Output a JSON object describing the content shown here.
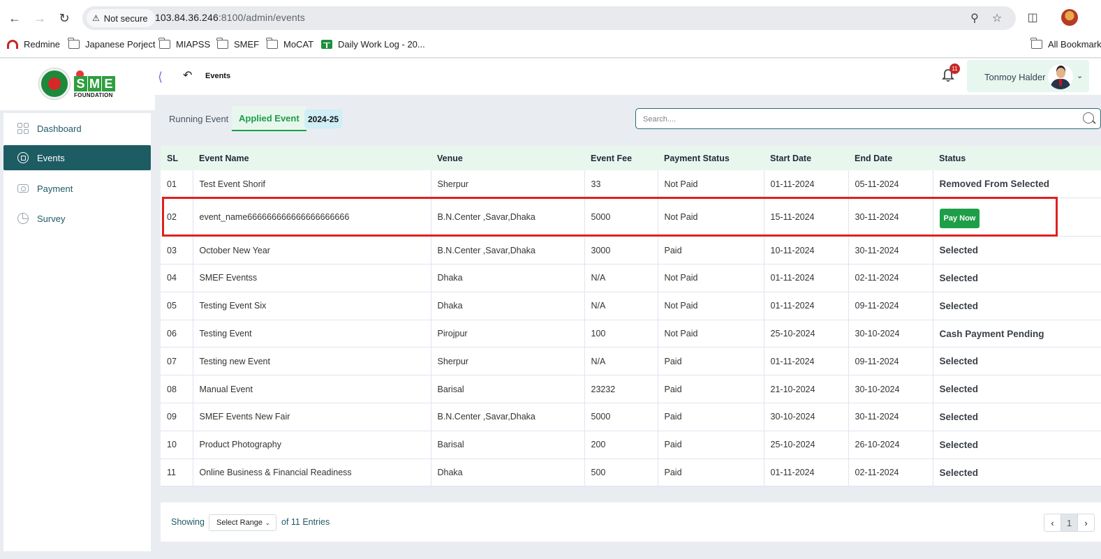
{
  "browser": {
    "security_label": "Not secure",
    "url_host": "103.84.36.246",
    "url_rest": ":8100/admin/events",
    "bookmarks": [
      "Redmine",
      "Japanese Porject",
      "MIAPSS",
      "SMEF",
      "MoCAT",
      "Daily Work Log - 20...",
      "All Bookmark"
    ]
  },
  "logo": {
    "letters": [
      "S",
      "M",
      "E"
    ],
    "sub": "FOUNDATION"
  },
  "header": {
    "title": "Events",
    "notification_count": "11",
    "user_name": "Tonmoy Halder"
  },
  "sidebar": {
    "items": [
      {
        "label": "Dashboard",
        "icon": "dashboard-icon"
      },
      {
        "label": "Events",
        "icon": "events-icon",
        "active": true
      },
      {
        "label": "Payment",
        "icon": "payment-icon"
      },
      {
        "label": "Survey",
        "icon": "survey-icon"
      }
    ]
  },
  "tabs": {
    "running": "Running Event",
    "applied": "Applied Event",
    "year": "2024-25"
  },
  "search": {
    "placeholder": "Search...."
  },
  "table": {
    "columns": [
      "SL",
      "Event Name",
      "Venue",
      "Event Fee",
      "Payment Status",
      "Start Date",
      "End Date",
      "Status"
    ],
    "rows": [
      [
        "01",
        "Test Event Shorif",
        "Sherpur",
        "33",
        "Not Paid",
        "01-11-2024",
        "05-11-2024",
        "Removed From Selected"
      ],
      [
        "02",
        "event_name666666666666666666666",
        "B.N.Center ,Savar,Dhaka",
        "5000",
        "Not Paid",
        "15-11-2024",
        "30-11-2024",
        "Pay Now"
      ],
      [
        "03",
        "October New Year",
        "B.N.Center ,Savar,Dhaka",
        "3000",
        "Paid",
        "10-11-2024",
        "30-11-2024",
        "Selected"
      ],
      [
        "04",
        "SMEF Eventss",
        "Dhaka",
        "N/A",
        "Not Paid",
        "01-11-2024",
        "02-11-2024",
        "Selected"
      ],
      [
        "05",
        "Testing Event Six",
        "Dhaka",
        "N/A",
        "Not Paid",
        "01-11-2024",
        "09-11-2024",
        "Selected"
      ],
      [
        "06",
        "Testing Event",
        "Pirojpur",
        "100",
        "Not Paid",
        "25-10-2024",
        "30-10-2024",
        "Cash Payment Pending"
      ],
      [
        "07",
        "Testing new Event",
        "Sherpur",
        "N/A",
        "Paid",
        "01-11-2024",
        "09-11-2024",
        "Selected"
      ],
      [
        "08",
        "Manual Event",
        "Barisal",
        "23232",
        "Paid",
        "21-10-2024",
        "30-10-2024",
        "Selected"
      ],
      [
        "09",
        "SMEF Events New Fair",
        "B.N.Center ,Savar,Dhaka",
        "5000",
        "Paid",
        "30-10-2024",
        "30-11-2024",
        "Selected"
      ],
      [
        "10",
        "Product Photography",
        "Barisal",
        "200",
        "Paid",
        "25-10-2024",
        "26-10-2024",
        "Selected"
      ],
      [
        "11",
        "Online Business & Financial Readiness",
        "Dhaka",
        "500",
        "Paid",
        "01-11-2024",
        "02-11-2024",
        "Selected"
      ]
    ]
  },
  "footer": {
    "showing": "Showing",
    "range_label": "Select Range",
    "of_entries": "of 11 Entries",
    "page": "1"
  },
  "colors": {
    "primary": "#1d5c63",
    "accent_green": "#1e9e48",
    "highlight_red": "#e02020"
  }
}
